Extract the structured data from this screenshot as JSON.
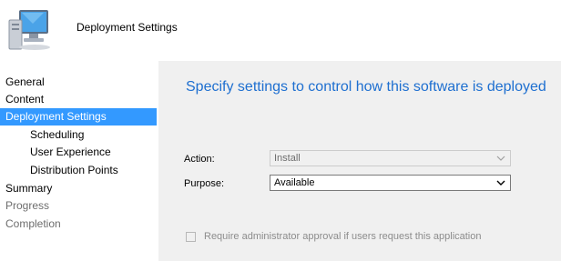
{
  "header": {
    "title": "Deployment Settings",
    "icon": "computer-monitor-icon"
  },
  "sidebar": {
    "items": [
      {
        "label": "General",
        "state": "normal"
      },
      {
        "label": "Content",
        "state": "normal"
      },
      {
        "label": "Deployment Settings",
        "state": "selected"
      },
      {
        "label": "Scheduling",
        "state": "normal"
      },
      {
        "label": "User Experience",
        "state": "normal"
      },
      {
        "label": "Distribution Points",
        "state": "normal"
      },
      {
        "label": "Summary",
        "state": "normal"
      },
      {
        "label": "Progress",
        "state": "disabled"
      },
      {
        "label": "Completion",
        "state": "disabled"
      }
    ]
  },
  "main": {
    "heading": "Specify settings to control how this software is deployed",
    "action": {
      "label": "Action:",
      "value": "Install",
      "enabled": false
    },
    "purpose": {
      "label": "Purpose:",
      "value": "Available",
      "enabled": true
    },
    "approval": {
      "label": "Require administrator approval if users request this application",
      "checked": false,
      "enabled": false
    }
  },
  "colors": {
    "selection": "#3399ff",
    "heading": "#1e6fd0",
    "panel": "#f0f0f0"
  }
}
